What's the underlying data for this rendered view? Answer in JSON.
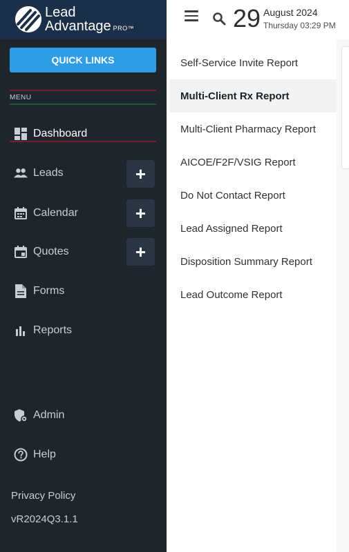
{
  "brand": {
    "name_line1": "Lead",
    "name_line2": "Advantage",
    "tier": "PRO™"
  },
  "sidebar": {
    "quick_links_label": "QUICK LINKS",
    "menu_label": "MENU",
    "items": [
      {
        "label": "Dashboard",
        "icon": "dashboard-icon",
        "active": true
      },
      {
        "label": "Leads",
        "icon": "people-icon",
        "has_add": true
      },
      {
        "label": "Calendar",
        "icon": "calendar-icon",
        "has_add": true
      },
      {
        "label": "Quotes",
        "icon": "event-icon",
        "has_add": true
      },
      {
        "label": "Forms",
        "icon": "document-icon"
      },
      {
        "label": "Reports",
        "icon": "bar-chart-icon"
      },
      {
        "label": "Admin",
        "icon": "admin-shield-icon"
      },
      {
        "label": "Help",
        "icon": "help-circle-icon"
      }
    ],
    "add_symbol": "+",
    "privacy_policy": "Privacy Policy",
    "version": "vR2024Q3.1.1"
  },
  "header": {
    "day": "29",
    "month_year": "August 2024",
    "weekday_time": "Thursday 03:29 PM"
  },
  "reports": {
    "items": [
      {
        "label": "Self-Service Invite Report"
      },
      {
        "label": "Multi-Client Rx Report",
        "active": true
      },
      {
        "label": "Multi-Client Pharmacy Report"
      },
      {
        "label": "AICOE/F2F/VSIG Report"
      },
      {
        "label": "Do Not Contact Report"
      },
      {
        "label": "Lead Assigned Report"
      },
      {
        "label": "Disposition Summary Report"
      },
      {
        "label": "Lead Outcome Report"
      }
    ]
  },
  "colors": {
    "sidebar_bg": "#1f252c",
    "brand_bg": "#1b3048",
    "accent": "#2f9ce8",
    "active_report_bg": "#f1f2f4"
  }
}
